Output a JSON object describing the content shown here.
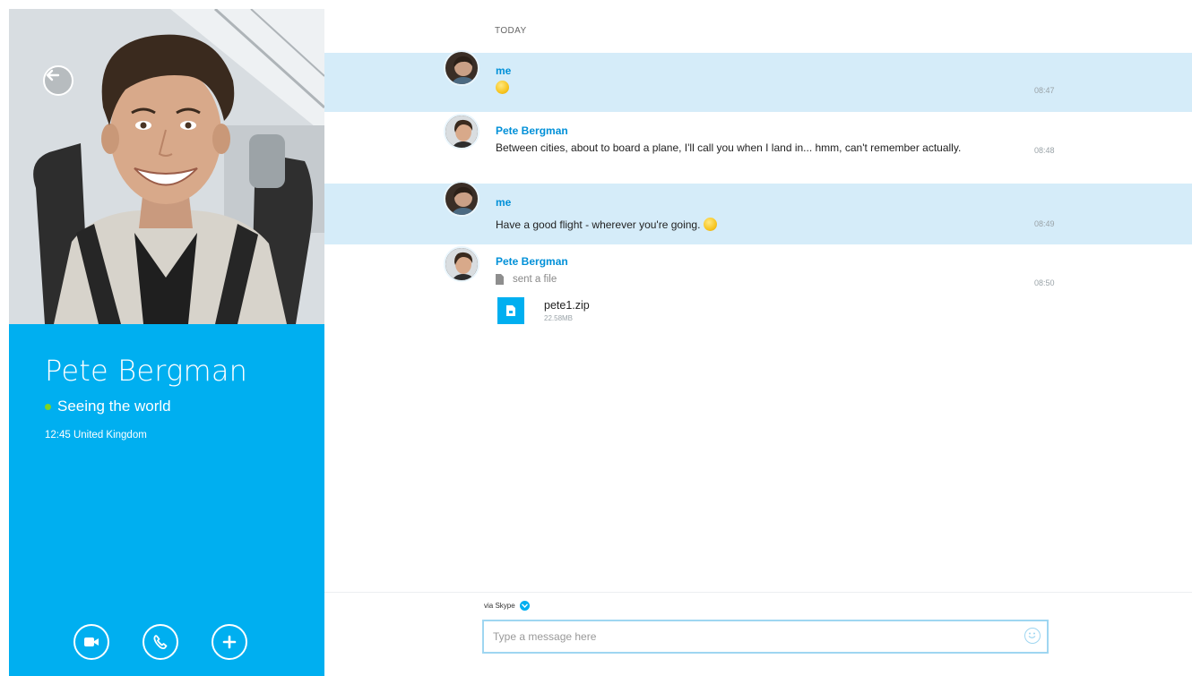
{
  "contact": {
    "name": "Pete Bergman",
    "mood": "Seeing the world",
    "local_time": "12:45 United Kingdom",
    "status_color": "#7fd322"
  },
  "icons": {
    "back": "back-arrow-icon",
    "video": "video-call-icon",
    "call": "phone-icon",
    "add": "plus-icon",
    "file": "file-icon",
    "emoji": "smiley-icon"
  },
  "conversation": {
    "day_label": "TODAY",
    "messages": [
      {
        "sender": "me",
        "text": "",
        "time": "08:47",
        "emoticon": "smile"
      },
      {
        "sender": "Pete Bergman",
        "text": "Between cities, about to board a plane, I'll call you when I land in... hmm, can't remember actually.",
        "time": "08:48"
      },
      {
        "sender": "me",
        "text": "Have a good flight - wherever you're going.",
        "time": "08:49",
        "emoticon": "grin"
      },
      {
        "sender": "Pete Bergman",
        "text": "sent a file",
        "time": "08:50",
        "file": {
          "name": "pete1.zip",
          "size": "22.58MB"
        }
      }
    ]
  },
  "composer": {
    "via_label": "via Skype",
    "placeholder": "Type a message here"
  },
  "colors": {
    "accent": "#00aff0",
    "my_message_bg": "#d5ecf9",
    "sender_name": "#0090d8"
  }
}
